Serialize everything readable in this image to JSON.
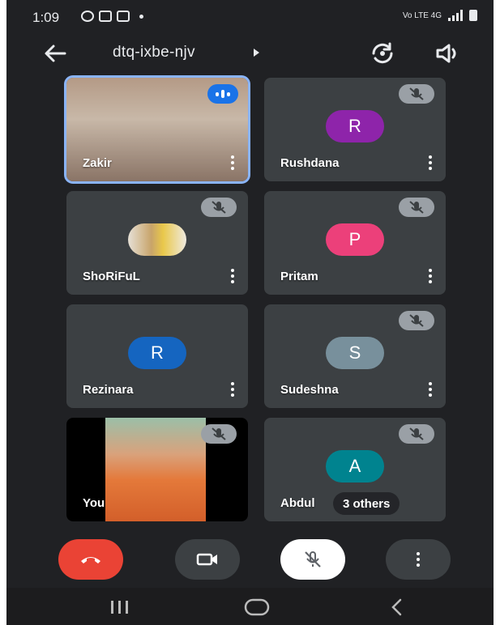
{
  "status_bar": {
    "time": "1:09",
    "network": "Vo LTE 4G"
  },
  "top_bar": {
    "meeting_code": "dtq-ixbe-njv"
  },
  "tiles": [
    {
      "name": "Zakir"
    },
    {
      "name": "Rushdana",
      "initial": "R",
      "color": "#8e24aa"
    },
    {
      "name": "ShoRiFuL"
    },
    {
      "name": "Pritam",
      "initial": "P",
      "color": "#ec407a"
    },
    {
      "name": "Rezinara",
      "initial": "R",
      "color": "#1565c0"
    },
    {
      "name": "Sudeshna",
      "initial": "S",
      "color": "#78909c"
    },
    {
      "name": "You"
    },
    {
      "name": "Abdul",
      "initial": "A",
      "color": "#00838f",
      "others_label": "3 others"
    }
  ],
  "colors": {
    "background": "#202124",
    "tile": "#3c4043",
    "end_call": "#ea4335",
    "active_border": "#8ab4f8",
    "speaking_badge": "#1a73e8"
  }
}
